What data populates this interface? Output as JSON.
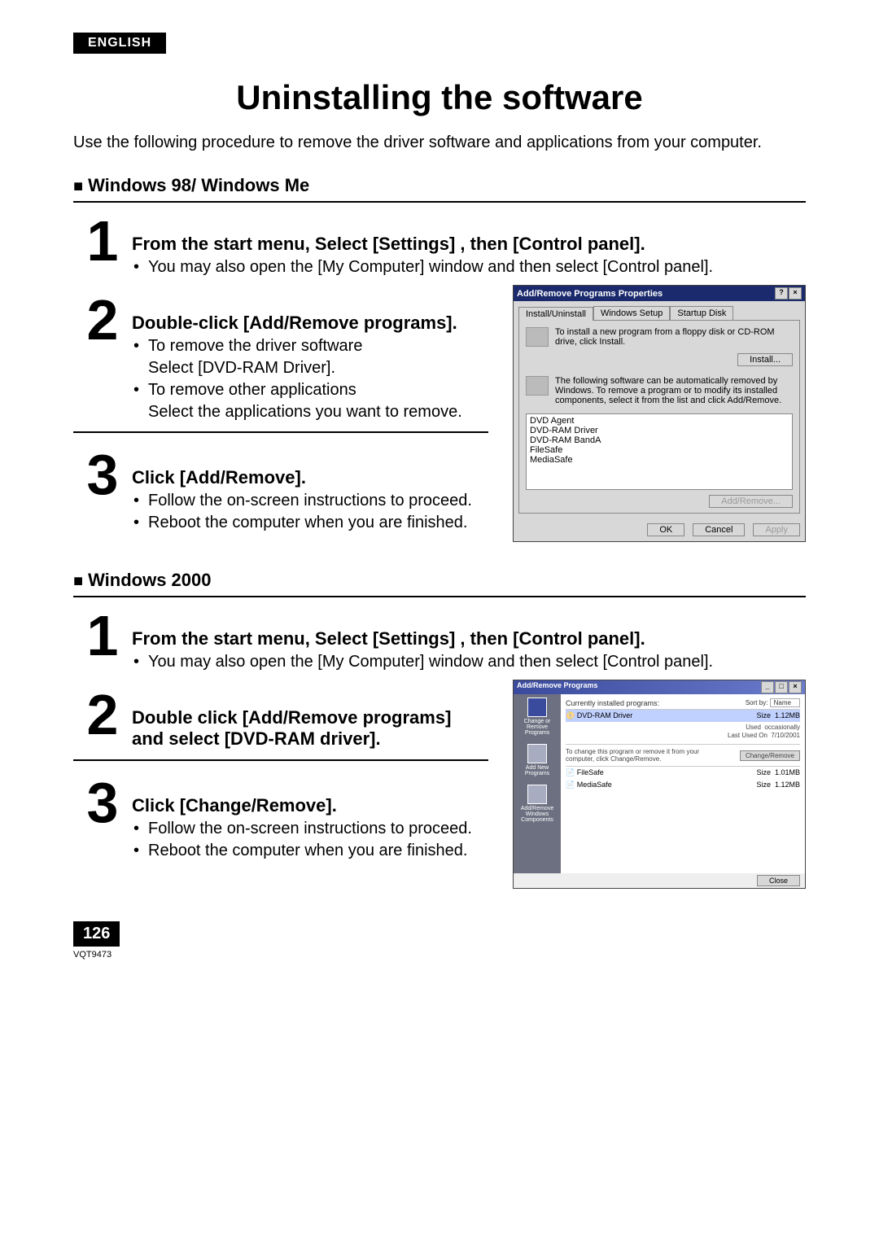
{
  "lang_tab": "ENGLISH",
  "title": "Uninstalling the software",
  "intro": "Use the following procedure to remove the driver software and applications from your computer.",
  "section_a": {
    "heading": "Windows 98/ Windows Me",
    "step1": {
      "num": "1",
      "title": "From the start menu, Select [Settings] , then [Control panel].",
      "bullet1": "You may also open the [My Computer] window and then select [Control panel]."
    },
    "step2": {
      "num": "2",
      "title": "Double-click [Add/Remove programs].",
      "bullet1": "To remove the driver software",
      "bullet1b": "Select [DVD-RAM Driver].",
      "bullet2": "To remove other applications",
      "bullet2b": "Select the applications you want to remove."
    },
    "step3": {
      "num": "3",
      "title": "Click [Add/Remove].",
      "bullet1": "Follow the on-screen instructions to proceed.",
      "bullet2": "Reboot the computer when you are finished."
    }
  },
  "dialog1": {
    "title": "Add/Remove Programs Properties",
    "help": "?",
    "close": "×",
    "tab1": "Install/Uninstall",
    "tab2": "Windows Setup",
    "tab3": "Startup Disk",
    "intro_text": "To install a new program from a floppy disk or CD-ROM drive, click Install.",
    "install_btn": "Install...",
    "remove_text": "The following software can be automatically removed by Windows. To remove a program or to modify its installed components, select it from the list and click Add/Remove.",
    "list": [
      "DVD Agent",
      "DVD-RAM Driver",
      "DVD-RAM BandA",
      "FileSafe",
      "MediaSafe"
    ],
    "addremove_btn": "Add/Remove...",
    "ok": "OK",
    "cancel": "Cancel",
    "apply": "Apply"
  },
  "section_b": {
    "heading": "Windows 2000",
    "step1": {
      "num": "1",
      "title": "From the start menu, Select [Settings] , then [Control panel].",
      "bullet1": "You may also open the [My Computer] window and then select [Control panel]."
    },
    "step2": {
      "num": "2",
      "title_a": "Double click [Add/Remove programs]",
      "title_b": "and select [DVD-RAM driver]."
    },
    "step3": {
      "num": "3",
      "title": "Click [Change/Remove].",
      "bullet1": "Follow the on-screen instructions to proceed.",
      "bullet2": "Reboot the computer when you are finished."
    }
  },
  "dialog2": {
    "title": "Add/Remove Programs",
    "side": {
      "a": "Change or Remove Programs",
      "b": "Add New Programs",
      "c": "Add/Remove Windows Components"
    },
    "top_label": "Currently installed programs:",
    "sort_label": "Sort by:",
    "sort_value": "Name",
    "sel_name": "DVD-RAM Driver",
    "sel_size_lbl": "Size",
    "sel_size": "1.12MB",
    "used_lbl": "Used",
    "used": "occasionally",
    "last_lbl": "Last Used On",
    "last": "7/10/2001",
    "change_text": "To change this program or remove it from your computer, click Change/Remove.",
    "change_btn": "Change/Remove",
    "row2_name": "FileSafe",
    "row2_size_lbl": "Size",
    "row2_size": "1.01MB",
    "row3_name": "MediaSafe",
    "row3_size_lbl": "Size",
    "row3_size": "1.12MB",
    "close": "Close"
  },
  "page_number": "126",
  "doc_code": "VQT9473"
}
